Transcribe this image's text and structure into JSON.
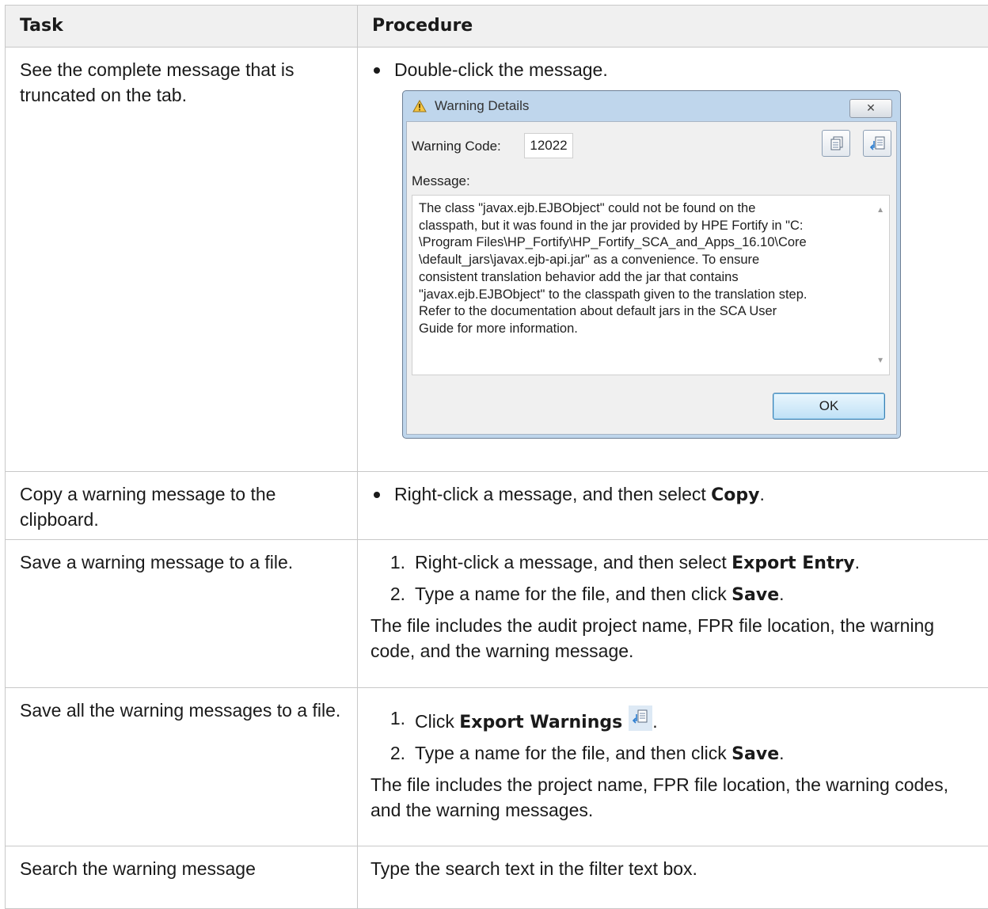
{
  "table": {
    "headers": {
      "task": "Task",
      "procedure": "Procedure"
    },
    "rows": [
      {
        "task": "See the complete message that is truncated on the tab.",
        "bullet": "Double-click the message."
      },
      {
        "task": "Copy a warning message to the clipboard.",
        "bullet_pre": "Right-click a message, and then select ",
        "bullet_bold": "Copy",
        "bullet_post": "."
      },
      {
        "task": "Save a warning message to a file.",
        "steps": [
          {
            "num": "1.",
            "pre": "Right-click a message, and then select ",
            "bold": "Export Entry",
            "post": "."
          },
          {
            "num": "2.",
            "pre": "Type a name for the file, and then click ",
            "bold": "Save",
            "post": "."
          }
        ],
        "note": "The file includes the audit project name, FPR file location, the warning code, and the warning message."
      },
      {
        "task": "Save all the warning messages to a file.",
        "steps": [
          {
            "num": "1.",
            "pre": "Click ",
            "bold": "Export Warnings",
            "post": "."
          },
          {
            "num": "2.",
            "pre": "Type a name for the file, and then click ",
            "bold": "Save",
            "post": "."
          }
        ],
        "note": "The file includes the project name, FPR file location, the warning codes, and the warning messages."
      },
      {
        "task": "Search the warning message",
        "text": "Type the search text in the filter text box."
      }
    ]
  },
  "dialog": {
    "title": "Warning Details",
    "close_glyph": "✕",
    "code_label": "Warning Code:",
    "code_value": "12022",
    "message_label": "Message:",
    "message_lines": [
      "The class \"javax.ejb.EJBObject\" could not be found on the",
      "classpath, but it was found in the jar provided by HPE Fortify in \"C:",
      "\\Program Files\\HP_Fortify\\HP_Fortify_SCA_and_Apps_16.10\\Core",
      "\\default_jars\\javax.ejb-api.jar\" as a convenience. To ensure",
      "consistent translation behavior add the jar that contains",
      "\"javax.ejb.EJBObject\" to the classpath given to the translation step.",
      "Refer to the documentation about default jars in the SCA User",
      "Guide for more information."
    ],
    "ok_label": "OK",
    "icons": {
      "title": "warning-icon",
      "copy": "copy-icon",
      "export": "export-warnings-icon"
    }
  }
}
